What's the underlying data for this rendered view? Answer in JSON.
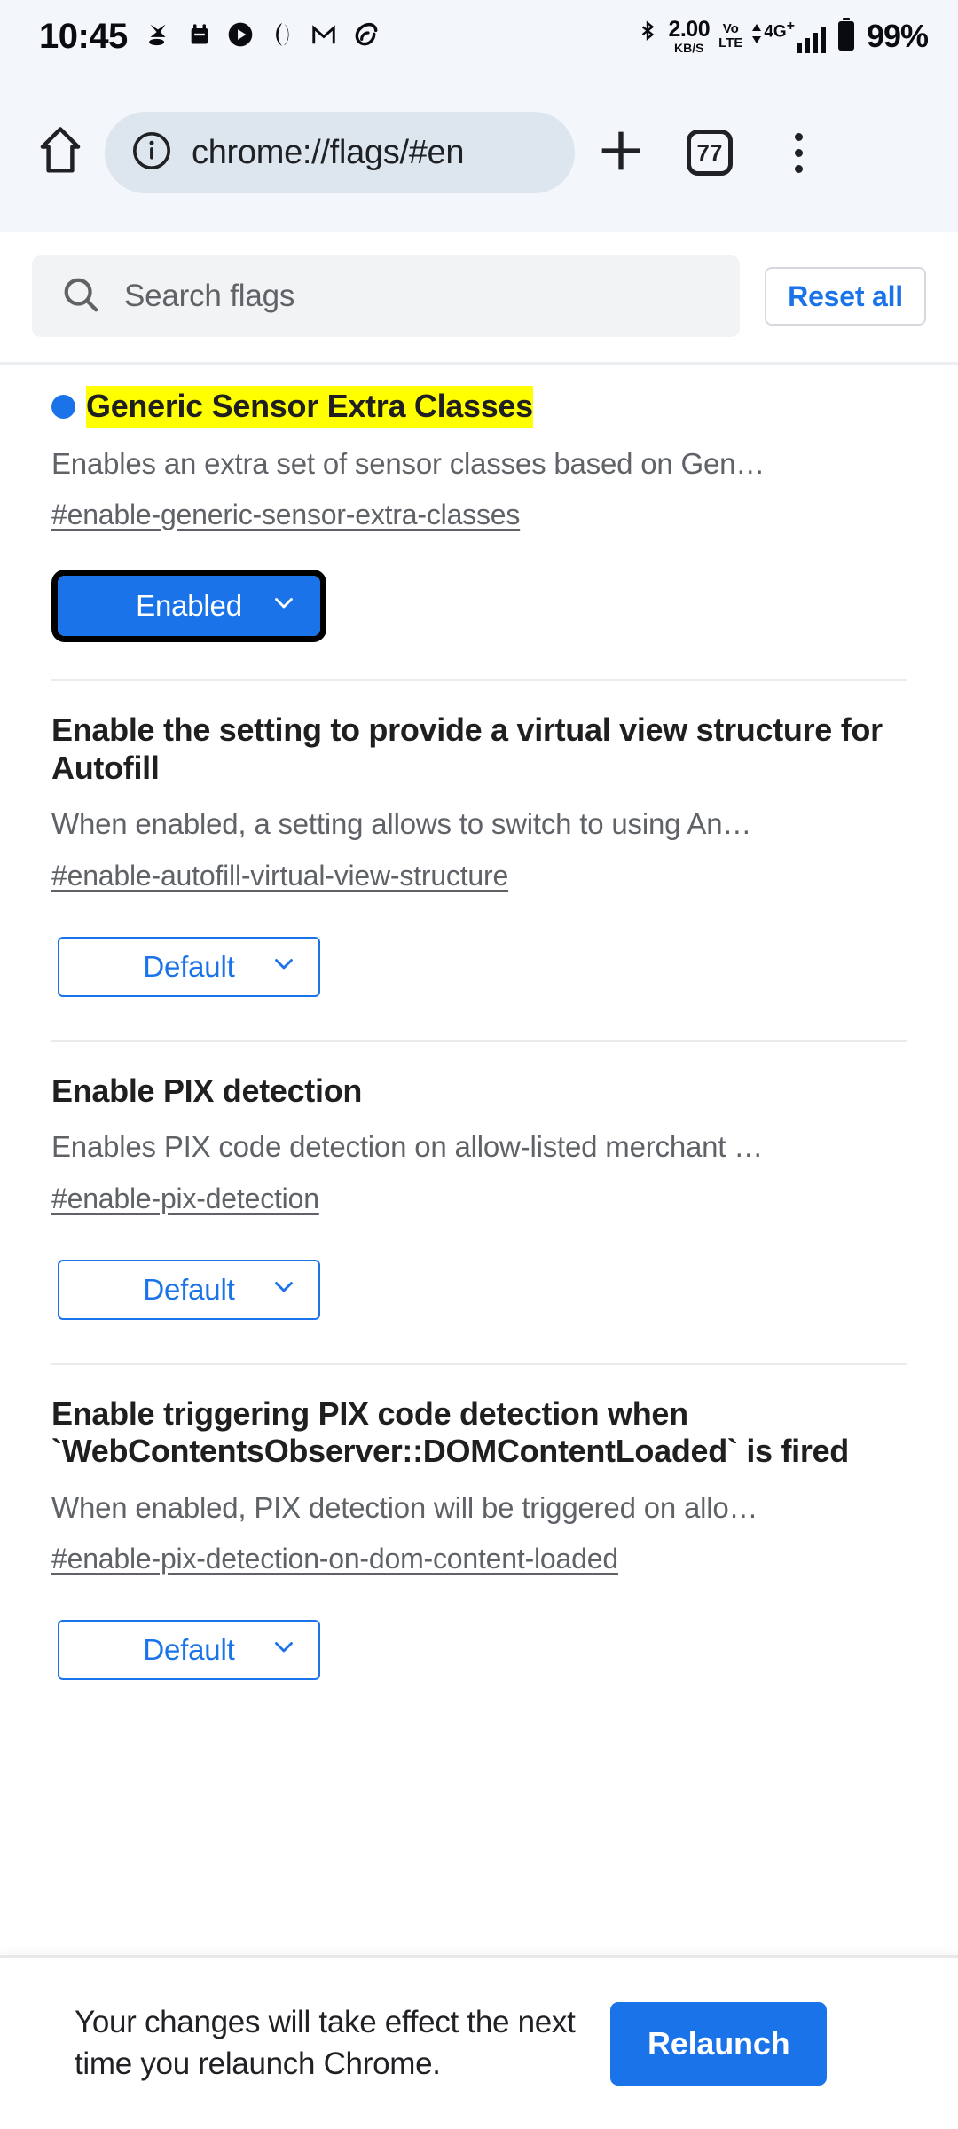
{
  "status_bar": {
    "time": "10:45",
    "left_icons": [
      "contact-silhouette-icon",
      "calendar-icon",
      "play-circle-icon",
      "opera-icon",
      "gmail-icon",
      "nothing-icon"
    ],
    "bluetooth_icon": "bluetooth-icon",
    "network_speed_value": "2.00",
    "network_speed_unit": "KB/S",
    "volte_top": "Vo",
    "volte_bottom": "LTE",
    "network_generation": "4G",
    "network_generation_sup": "+",
    "battery_percent": "99%"
  },
  "browser_bar": {
    "home_icon": "home-icon",
    "page_info_icon": "info-circle-icon",
    "url": "chrome://flags/#en",
    "new_tab_icon": "plus-icon",
    "tab_count": "77",
    "menu_icon": "kebab-menu-icon"
  },
  "search": {
    "placeholder": "Search flags",
    "icon": "search-icon",
    "reset_label": "Reset all"
  },
  "flags": [
    {
      "title": "Generic Sensor Extra Classes",
      "highlighted": true,
      "has_dot": true,
      "description": "Enables an extra set of sensor classes based on Gen…",
      "id": "#enable-generic-sensor-extra-classes",
      "select_value": "Enabled",
      "select_state": "enabled-focused"
    },
    {
      "title": "Enable the setting to provide a virtual view structure for Autofill",
      "highlighted": false,
      "has_dot": false,
      "description": "When enabled, a setting allows to switch to using An…",
      "id": "#enable-autofill-virtual-view-structure",
      "select_value": "Default",
      "select_state": "default"
    },
    {
      "title": "Enable PIX detection",
      "highlighted": false,
      "has_dot": false,
      "description": "Enables PIX code detection on allow-listed merchant …",
      "id": "#enable-pix-detection",
      "select_value": "Default",
      "select_state": "default"
    },
    {
      "title": "Enable triggering PIX code detection when `WebContentsObserver::DOMContentLoaded` is fired",
      "highlighted": false,
      "has_dot": false,
      "description": "When enabled, PIX detection will be triggered on allo…",
      "id": "#enable-pix-detection-on-dom-content-loaded",
      "select_value": "Default",
      "select_state": "default"
    }
  ],
  "bottom_bar": {
    "message": "Your changes will take effect the next time you relaunch Chrome.",
    "relaunch_label": "Relaunch"
  },
  "colors": {
    "accent_blue": "#1a73e8",
    "highlight_yellow": "#ffff00",
    "chrome_bar_bg": "#f3f6fb",
    "omnibox_bg": "#dde6ee",
    "muted_text": "#5f6368"
  }
}
